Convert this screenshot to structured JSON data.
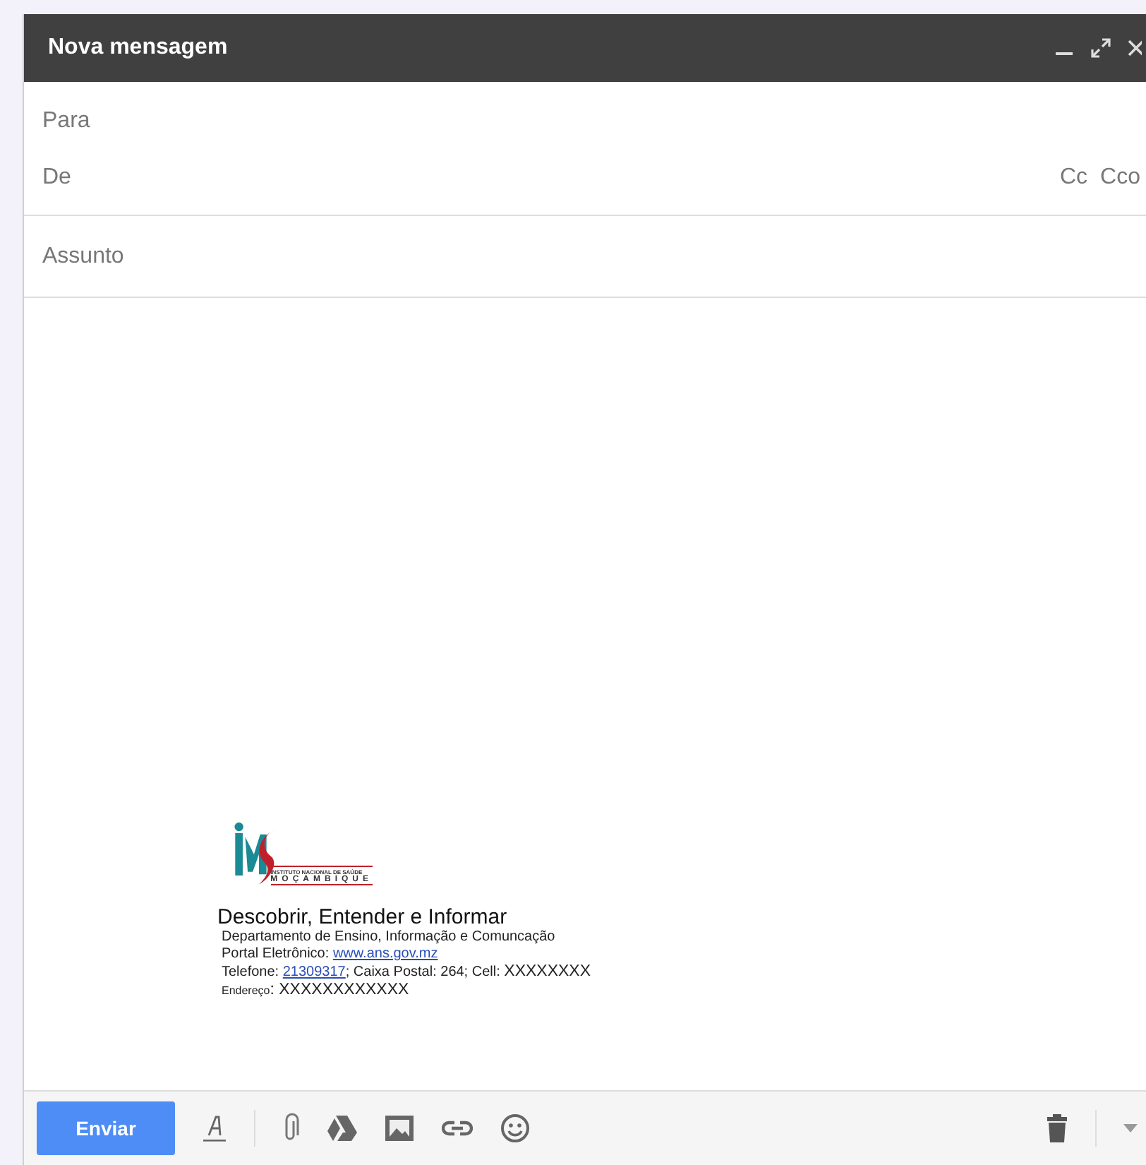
{
  "window": {
    "title": "Nova mensagem"
  },
  "fields": {
    "to_label": "Para",
    "from_label": "De",
    "cc": "Cc",
    "bcc": "Cco",
    "subject_placeholder": "Assunto"
  },
  "signature": {
    "logo_lines": [
      "INSTITUTO NACIONAL DE SAÚDE",
      "MOÇAMBIQUE"
    ],
    "tagline": "Descobrir, Entender e Informar",
    "lines": [
      [
        {
          "kind": "text",
          "text": "Departamento de Ensino, Informação e Comuncação"
        }
      ],
      [
        {
          "kind": "text",
          "text": "Portal Eletrônico: "
        },
        {
          "kind": "link",
          "text": "www.ans.gov.mz"
        }
      ],
      [
        {
          "kind": "text",
          "text": "Telefone: "
        },
        {
          "kind": "link",
          "text": "21309317"
        },
        {
          "kind": "text",
          "text": "; Caixa Postal: 264; Cell: "
        },
        {
          "kind": "large",
          "text": "XXXXXXXX"
        }
      ],
      [
        {
          "kind": "small",
          "text": "Endereço"
        },
        {
          "kind": "large",
          "text": ": XXXXXXXXXXXX"
        }
      ]
    ]
  },
  "toolbar": {
    "send": "Enviar"
  }
}
